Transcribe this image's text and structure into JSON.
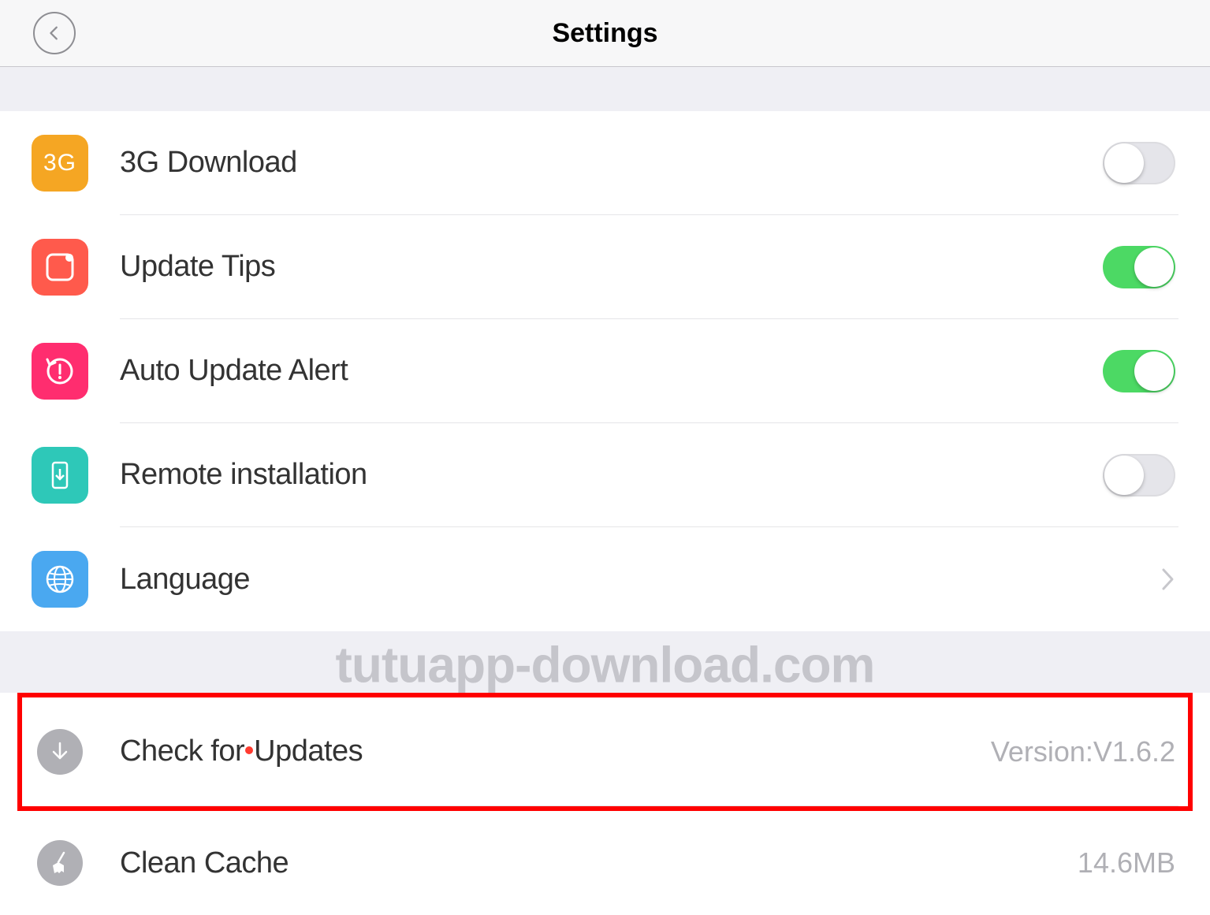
{
  "header": {
    "title": "Settings"
  },
  "group1": {
    "items": [
      {
        "label": "3G Download",
        "toggle": false,
        "iconText": "3G"
      },
      {
        "label": "Update Tips",
        "toggle": true
      },
      {
        "label": "Auto Update Alert",
        "toggle": true
      },
      {
        "label": "Remote installation",
        "toggle": false
      },
      {
        "label": "Language"
      }
    ]
  },
  "group2": {
    "items": [
      {
        "label_a": "Check for",
        "label_b": "Updates",
        "value": "Version:V1.6.2"
      },
      {
        "label": "Clean Cache",
        "value": "14.6MB"
      }
    ]
  },
  "watermark": "tutuapp-download.com"
}
